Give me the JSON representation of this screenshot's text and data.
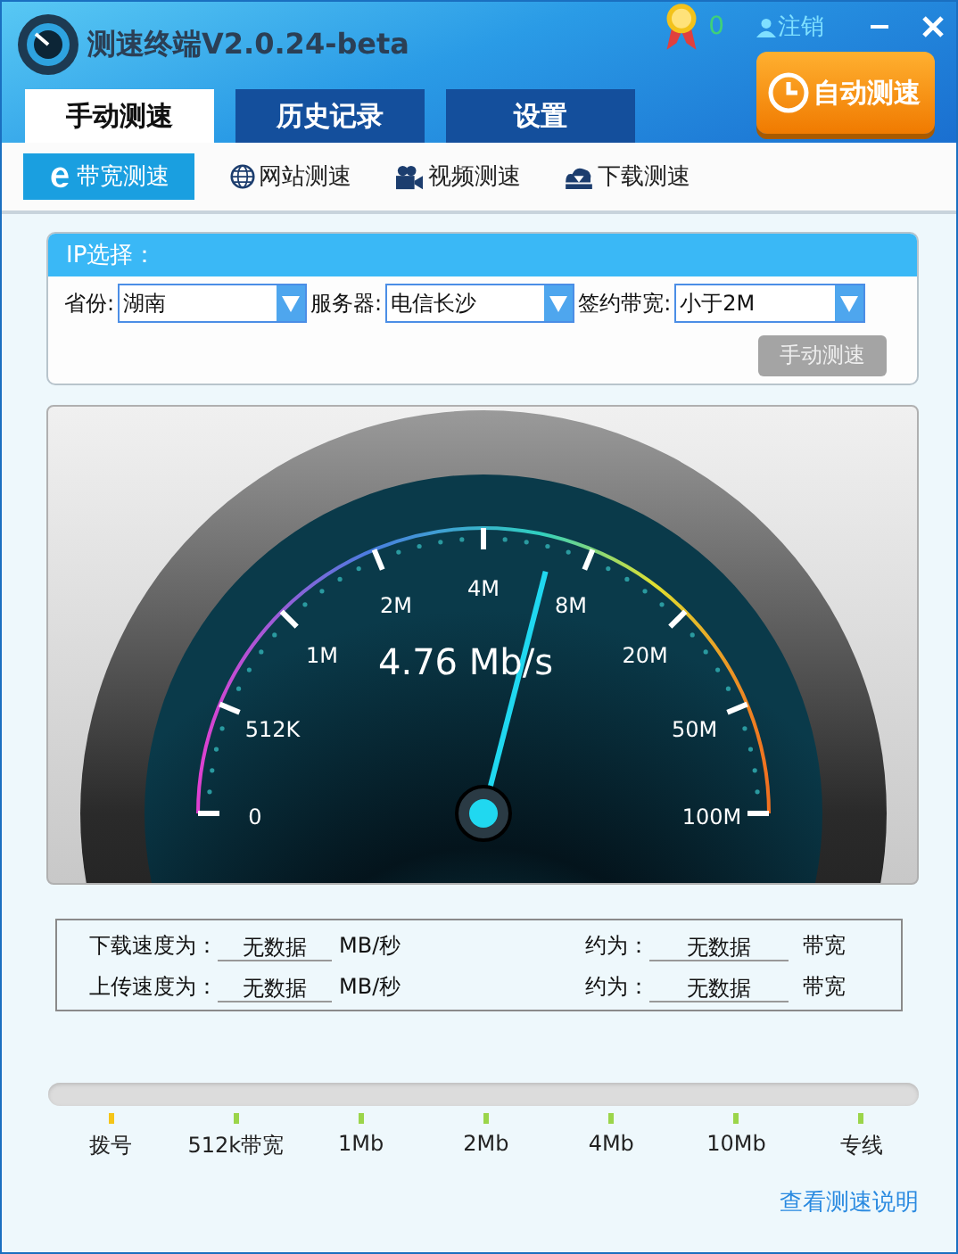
{
  "window": {
    "title": "测速终端V2.0.24-beta"
  },
  "header": {
    "medal_count": "0",
    "logout": "注销",
    "auto_test_button": "自动测速"
  },
  "tabs": [
    {
      "label": "手动测速",
      "selected": true
    },
    {
      "label": "历史记录",
      "selected": false
    },
    {
      "label": "设置",
      "selected": false
    }
  ],
  "sub_tabs": [
    {
      "label": "带宽测速",
      "kind": "ie",
      "selected": true
    },
    {
      "label": "网站测速",
      "kind": "globe",
      "selected": false
    },
    {
      "label": "视频测速",
      "kind": "camera",
      "selected": false
    },
    {
      "label": "下载测速",
      "kind": "download",
      "selected": false
    }
  ],
  "ip_panel": {
    "title": "IP选择：",
    "fields": [
      {
        "label": "省份:",
        "value": "湖南"
      },
      {
        "label": "服务器:",
        "value": "电信长沙"
      },
      {
        "label": "签约带宽:",
        "value": "小于2M"
      }
    ],
    "button": {
      "label": "手动测速",
      "disabled": true
    }
  },
  "gauge": {
    "reading": "4.76 Mb/s",
    "level": 0.58,
    "scale": [
      "0",
      "512K",
      "1M",
      "2M",
      "4M",
      "8M",
      "20M",
      "50M",
      "100M"
    ]
  },
  "results": {
    "rows": [
      {
        "label": "下载速度为：",
        "value": "无数据",
        "unit": "MB/秒",
        "approx_label": "约为：",
        "approx_value": "无数据",
        "approx_unit": "带宽"
      },
      {
        "label": "上传速度为：",
        "value": "无数据",
        "unit": "MB/秒",
        "approx_label": "约为：",
        "approx_value": "无数据",
        "approx_unit": "带宽"
      }
    ]
  },
  "bandwidth_scale": {
    "marks": [
      {
        "label": "拨号",
        "color": "#f5c518"
      },
      {
        "label": "512k带宽",
        "color": "#9bd54a"
      },
      {
        "label": "1Mb",
        "color": "#9bd54a"
      },
      {
        "label": "2Mb",
        "color": "#9bd54a"
      },
      {
        "label": "4Mb",
        "color": "#9bd54a"
      },
      {
        "label": "10Mb",
        "color": "#9bd54a"
      },
      {
        "label": "专线",
        "color": "#9bd54a"
      }
    ]
  },
  "help_link": "查看测速说明"
}
